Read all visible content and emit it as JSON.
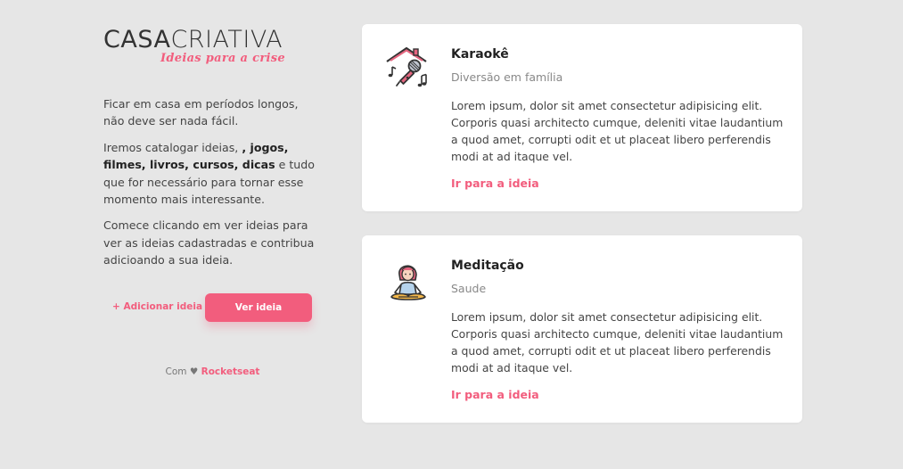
{
  "brand": {
    "name_part1": "CASA",
    "name_part2": "CRIATIVA",
    "tagline": "Ideias para a crise",
    "accent_color": "#f25d7d"
  },
  "intro": {
    "paragraph1": "Ficar em casa em períodos longos, não deve ser nada fácil.",
    "paragraph2_before": "Iremos catalogar ideias, ",
    "paragraph2_bold": ", jogos, filmes, livros, cursos, dicas",
    "paragraph2_after": " e tudo que for necessário para tornar esse momento mais interessante.",
    "paragraph3": "Comece clicando em ver ideias para ver as ideias cadastradas e contribua adicioando a sua ideia."
  },
  "actions": {
    "add_label": "+ Adicionar ideia",
    "view_label": "Ver ideia"
  },
  "credits": {
    "prefix": "Com ♥ ",
    "brand": "Rocketseat"
  },
  "ideas": [
    {
      "icon": "karaoke-microphone-icon",
      "title": "Karaokê",
      "category": "Diversão em família",
      "description": "Lorem ipsum, dolor sit amet consectetur adipisicing elit. Corporis quasi architecto cumque, deleniti vitae laudantium a quod amet, corrupti odit et ut placeat libero perferendis modi at ad itaque vel.",
      "link_label": "Ir para a ideia"
    },
    {
      "icon": "meditation-person-icon",
      "title": "Meditação",
      "category": "Saude",
      "description": "Lorem ipsum, dolor sit amet consectetur adipisicing elit. Corporis quasi architecto cumque, deleniti vitae laudantium a quod amet, corrupti odit et ut placeat libero perferendis modi at ad itaque vel.",
      "link_label": "Ir para a ideia"
    }
  ]
}
